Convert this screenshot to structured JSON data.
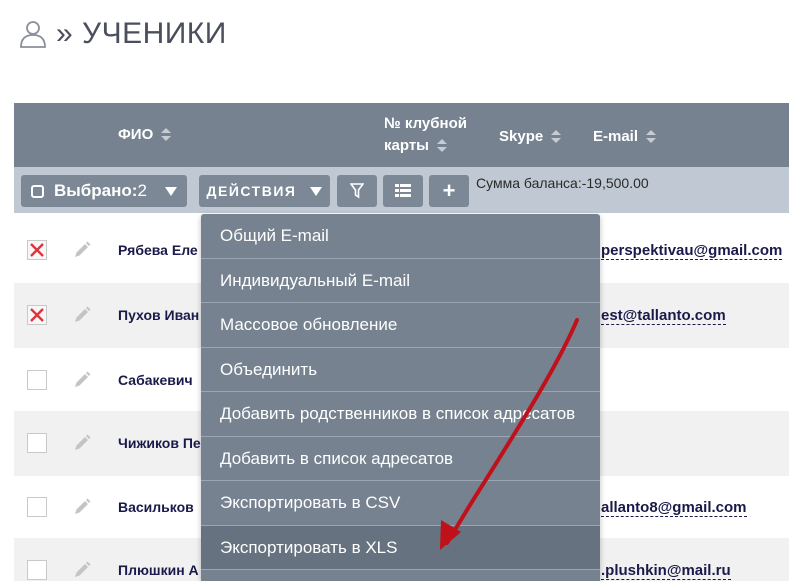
{
  "header": {
    "icon": "user-icon",
    "title": "» УЧЕНИКИ"
  },
  "table": {
    "columns": [
      {
        "label": "ФИО"
      },
      {
        "label_line1": "№ клубной",
        "label_line2": "карты"
      },
      {
        "label": "Skype"
      },
      {
        "label": "E-mail"
      }
    ]
  },
  "toolbar": {
    "selected_label": "Выбрано:",
    "selected_count": "2",
    "actions_label": "ДЕЙСТВИЯ",
    "balance_text": "Сумма баланса:-19,500.00",
    "plus_label": "+"
  },
  "rows": [
    {
      "checked": true,
      "fio": "Рябева Еле",
      "email": "perspektivau@gmail.com"
    },
    {
      "checked": true,
      "fio": "Пухов Иван",
      "email": "est@tallanto.com"
    },
    {
      "checked": false,
      "fio": "Сабакевич",
      "email": ""
    },
    {
      "checked": false,
      "fio": "Чижиков Пе",
      "email": ""
    },
    {
      "checked": false,
      "fio": "Васильков",
      "email": "allanto8@gmail.com"
    },
    {
      "checked": false,
      "fio": "Плюшкин А",
      "email": ".plushkin@mail.ru"
    }
  ],
  "actions_menu": {
    "items": [
      {
        "label": "Общий E-mail"
      },
      {
        "label": "Индивидуальный E-mail"
      },
      {
        "label": "Массовое обновление"
      },
      {
        "label": "Объединить"
      },
      {
        "label": "Добавить родственников в список адресатов"
      },
      {
        "label": "Добавить в список адресатов"
      },
      {
        "label": "Экспортировать в CSV"
      },
      {
        "label": "Экспортировать в XLS",
        "highlighted": true
      }
    ]
  },
  "colors": {
    "header_bg": "#76828f",
    "toolbar_bg": "#c0c9d3",
    "menu_bg": "#76828f",
    "annotation_arrow": "#c0101a"
  }
}
